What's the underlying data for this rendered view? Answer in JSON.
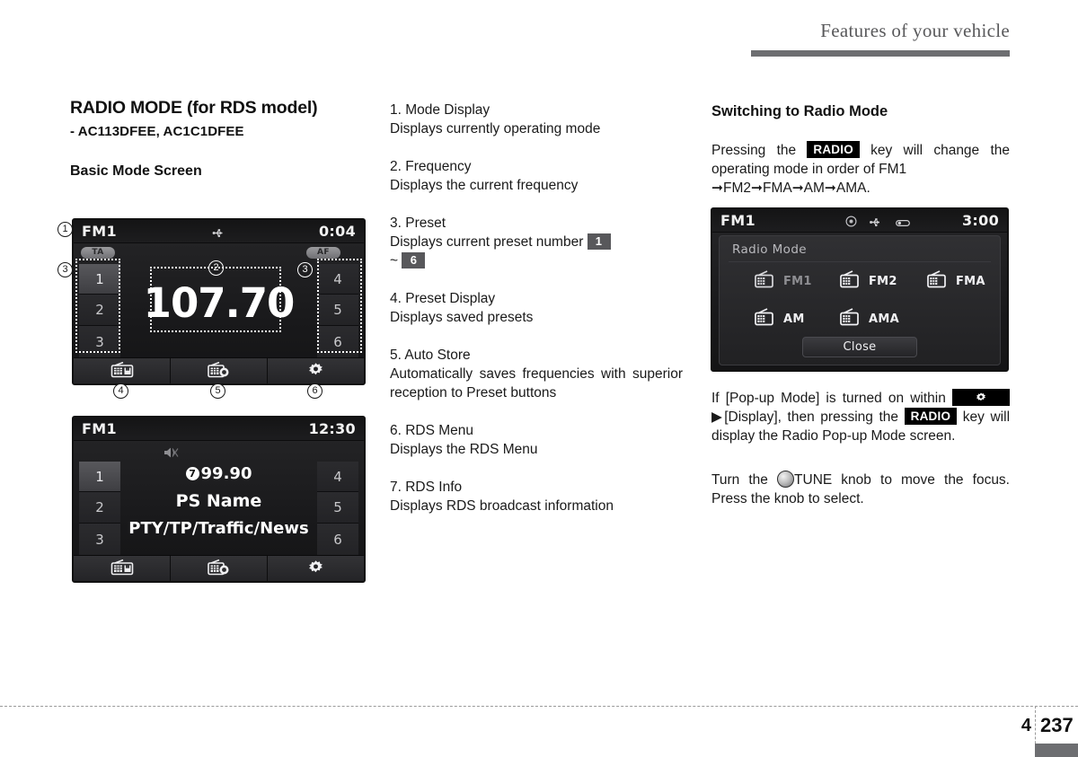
{
  "header": {
    "title": "Features of your vehicle"
  },
  "footer": {
    "chapter": "4",
    "page": "237"
  },
  "left": {
    "section_title": "RADIO MODE (for RDS model)",
    "model_codes": "- AC113DFEE,  AC1C1DFEE",
    "sub_title": "Basic Mode Screen",
    "screen_basic": {
      "mode": "FM1",
      "clock": "0:04",
      "icons": [
        "usb-icon"
      ],
      "pill_left": "TA",
      "pill_right": "AF",
      "presets_left": [
        "1",
        "2",
        "3"
      ],
      "presets_right": [
        "4",
        "5",
        "6"
      ],
      "frequency": "107.70",
      "buttons": [
        "preset-store-icon",
        "auto-store-icon",
        "settings-gear-icon"
      ],
      "callouts": {
        "mode": "1",
        "frequency": "2",
        "preset_left": "3",
        "preset_right": "3",
        "btn1": "4",
        "btn2": "5",
        "btn3": "6"
      }
    },
    "screen_rds": {
      "mode": "FM1",
      "clock": "12:30",
      "icons": [
        "mute-speaker-icon"
      ],
      "presets_left": [
        "1",
        "2",
        "3"
      ],
      "presets_right": [
        "4",
        "5",
        "6"
      ],
      "rds_marker": "7",
      "frequency": "99.90",
      "ps_name": "PS Name",
      "pty_line": "PTY/TP/Traffic/News",
      "buttons": [
        "preset-store-icon",
        "auto-store-icon",
        "settings-gear-icon"
      ]
    }
  },
  "middle": {
    "items": [
      {
        "num": "1. Mode Display",
        "desc": "Displays currently operating mode"
      },
      {
        "num": "2. Frequency",
        "desc": "Displays the current frequency"
      },
      {
        "num": "3. Preset",
        "desc_a": "Displays current preset number",
        "badge_a": "1",
        "desc_b": "~",
        "badge_b": "6"
      },
      {
        "num": "4. Preset Display",
        "desc": "Displays saved presets"
      },
      {
        "num": "5. Auto Store",
        "desc": "Automatically saves frequencies with superior reception to Preset buttons"
      },
      {
        "num": "6. RDS Menu",
        "desc": "Displays the RDS Menu"
      },
      {
        "num": "7. RDS Info",
        "desc": "Displays RDS broadcast information"
      }
    ]
  },
  "right": {
    "title": "Switching to Radio Mode",
    "para1_a": "Pressing the",
    "key_radio": "RADIO",
    "para1_b": "key will change the operating mode in order of FM1",
    "para1_c": "➞FM2➞FMA➞AM➞AMA.",
    "popup_screen": {
      "mode": "FM1",
      "clock": "3:00",
      "icons": [
        "disc-icon",
        "usb-icon",
        "aux-icon"
      ],
      "panel_title": "Radio Mode",
      "options": [
        "FM1",
        "FM2",
        "FMA",
        "AM",
        "AMA"
      ],
      "selected_option": "FM1",
      "close_label": "Close"
    },
    "para2_a": "If [Pop-up Mode] is turned on within",
    "gear_key": "gear-icon",
    "para2_b": "▶[Display], then pressing the",
    "key_radio2": "RADIO",
    "para2_c": "key will display the Radio Pop-up Mode screen.",
    "para3_a": "Turn the",
    "knob": "tune-knob-icon",
    "para3_b": "TUNE knob to move the focus. Press the knob to select."
  }
}
